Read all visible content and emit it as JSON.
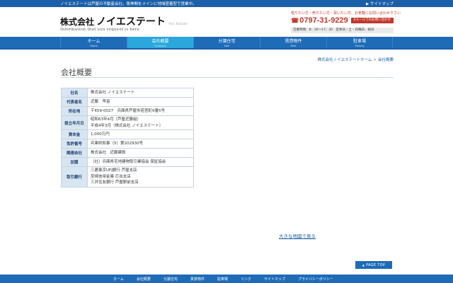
{
  "topbar": {
    "tagline": "ノイエステートは芦屋の不動産会社。阪神間をメインに地域密着型で営業中。",
    "sitemap": "サイトマップ"
  },
  "header": {
    "corp": "株式会社",
    "company_name": "ノイエステート",
    "en_mark": "Noi Estate",
    "catch": "Information that you request is here"
  },
  "contact": {
    "message": "借りたい方・売りたい方・買いたい方、お気軽にお問い合わせ下さい",
    "tel": "0797-31-9229",
    "mail_button": "Eメールでのお問い合わせ",
    "hours": "営業時間：8：30～17：30　定休日／土・日曜日、祝日"
  },
  "nav": {
    "items": [
      {
        "label": "ホーム",
        "sub": "Home"
      },
      {
        "label": "会社概要",
        "sub": "Company"
      },
      {
        "label": "分譲住宅",
        "sub": "Sale"
      },
      {
        "label": "賃貸物件",
        "sub": "Rent"
      },
      {
        "label": "駐車場",
        "sub": "Parking"
      }
    ],
    "active_index": 1
  },
  "breadcrumb": {
    "home": "株式会社ノイエステートホーム",
    "separator": ">",
    "current": "会社概要"
  },
  "page_title": "会社概要",
  "company_table": [
    {
      "label": "社名",
      "lines": [
        "株式会社 ノイエステート"
      ]
    },
    {
      "label": "代表者名",
      "lines": [
        "近藤　早苗"
      ]
    },
    {
      "label": "所在地",
      "lines": [
        "〒659-0027　兵庫県芦屋市若宮町6番5号"
      ]
    },
    {
      "label": "設立年月日",
      "lines": [
        "昭和63年4月（芦屋近藤組）",
        "平成4年3月（株式会社 ノイエステート）"
      ]
    },
    {
      "label": "資本金",
      "lines": [
        "1,000万円"
      ]
    },
    {
      "label": "免許番号",
      "lines": [
        "兵庫県知事（5）第202930号"
      ]
    },
    {
      "label": "関連会社",
      "lines": [
        "株式会社　近藤建設"
      ]
    },
    {
      "label": "加盟",
      "lines": [
        "（社）兵庫県宅地建物取引業協会 保証協会"
      ]
    },
    {
      "label": "取引銀行",
      "lines": [
        "三菱東京UFJ銀行 芦屋支店",
        "尼崎信用金庫 打出支店",
        "三井住友銀行 芦屋駅前支店"
      ]
    }
  ],
  "map_link": "大きな地図で見る",
  "pagetop": "PAGE TOP",
  "footer": {
    "links": [
      "ホーム",
      "会社概要",
      "分譲住宅",
      "賃貸物件",
      "駐車場",
      "リンク",
      "サイトマップ",
      "プライバシーポリシー"
    ]
  },
  "colors": {
    "primary_blue": "#1e6bb8",
    "active_tab": "#2aa8dc",
    "accent_red": "#c0392b",
    "table_header": "#d8e6f2"
  }
}
